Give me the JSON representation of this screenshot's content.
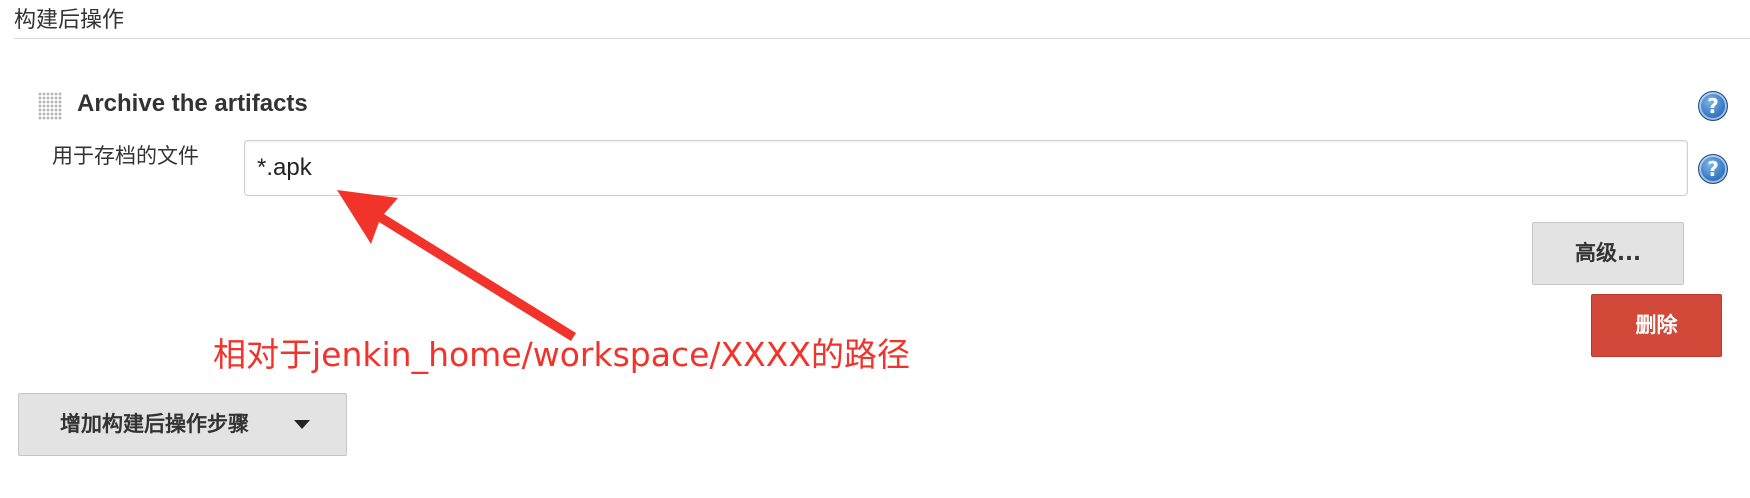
{
  "section": {
    "title": "构建后操作"
  },
  "archive_step": {
    "title": "Archive the artifacts",
    "help_icon": "help-icon",
    "files_field": {
      "label": "用于存档的文件",
      "value": "*.apk",
      "help_icon": "help-icon"
    },
    "advanced_label": "高级...",
    "delete_label": "删除"
  },
  "annotation": {
    "text": "相对于jenkin_home/workspace/XXXX的路径",
    "color": "#f2332b"
  },
  "add_step": {
    "label": "增加构建后操作步骤",
    "icon": "caret-down-icon"
  },
  "colors": {
    "delete_button": "#d24939",
    "button_gray": "#e3e3e3",
    "help_blue": "#3a7cc6"
  }
}
